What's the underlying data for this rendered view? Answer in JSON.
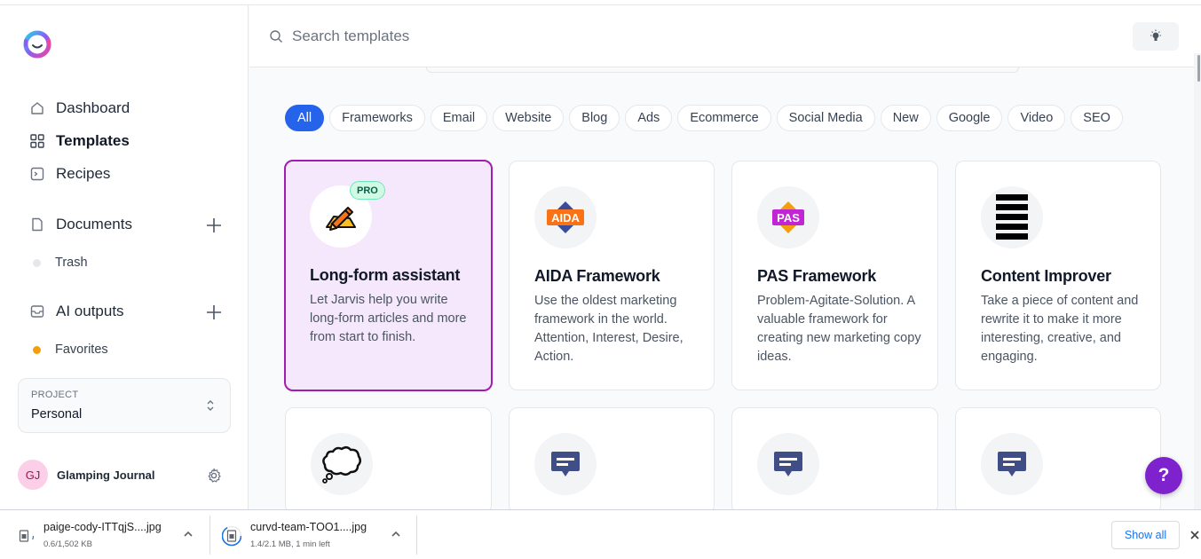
{
  "sidebar": {
    "logo_icon": "jasper-logo-icon",
    "nav": [
      {
        "label": "Dashboard",
        "icon": "home-icon"
      },
      {
        "label": "Templates",
        "icon": "grid-icon"
      },
      {
        "label": "Recipes",
        "icon": "terminal-icon"
      }
    ],
    "documents": {
      "label": "Documents",
      "icon": "document-icon",
      "sub": {
        "label": "Trash",
        "color": "#e5e7eb"
      }
    },
    "ai_outputs": {
      "label": "AI outputs",
      "icon": "inbox-icon",
      "sub": {
        "label": "Favorites",
        "color": "#f59e0b"
      }
    },
    "project": {
      "label": "PROJECT",
      "value": "Personal"
    },
    "user": {
      "initials": "GJ",
      "name": "Glamping Journal"
    }
  },
  "search": {
    "placeholder": "Search templates"
  },
  "filters": [
    "All",
    "Frameworks",
    "Email",
    "Website",
    "Blog",
    "Ads",
    "Ecommerce",
    "Social Media",
    "New",
    "Google",
    "Video",
    "SEO"
  ],
  "active_filter": "All",
  "cards": [
    {
      "title": "Long-form assistant",
      "desc": "Let Jarvis help you write long-form articles and more from start to finish.",
      "badge": "PRO",
      "icon": "pencil-document-icon"
    },
    {
      "title": "AIDA Framework",
      "desc": "Use the oldest marketing framework in the world. Attention, Interest, Desire, Action.",
      "icon": "aida-badge-icon",
      "icon_text": "AIDA"
    },
    {
      "title": "PAS Framework",
      "desc": "Problem-Agitate-Solution. A valuable framework for creating new marketing copy ideas.",
      "icon": "pas-badge-icon",
      "icon_text": "PAS"
    },
    {
      "title": "Content Improver",
      "desc": "Take a piece of content and rewrite it to make it more interesting, creative, and engaging.",
      "icon": "stacked-lines-icon"
    },
    {
      "icon": "thought-bubble-icon"
    },
    {
      "icon": "chat-message-icon"
    },
    {
      "icon": "chat-message-icon"
    },
    {
      "icon": "chat-message-icon"
    }
  ],
  "help": {
    "label": "?"
  },
  "downloads": [
    {
      "name": "paige-cody-ITTqjS....jpg",
      "progress": "0.6/1,502 KB"
    },
    {
      "name": "curvd-team-TOO1....jpg",
      "progress": "1.4/2.1 MB, 1 min left"
    }
  ],
  "show_all": "Show all",
  "colors": {
    "accent": "#2563eb",
    "selected_border": "#a21caf",
    "help": "#7e22ce"
  }
}
